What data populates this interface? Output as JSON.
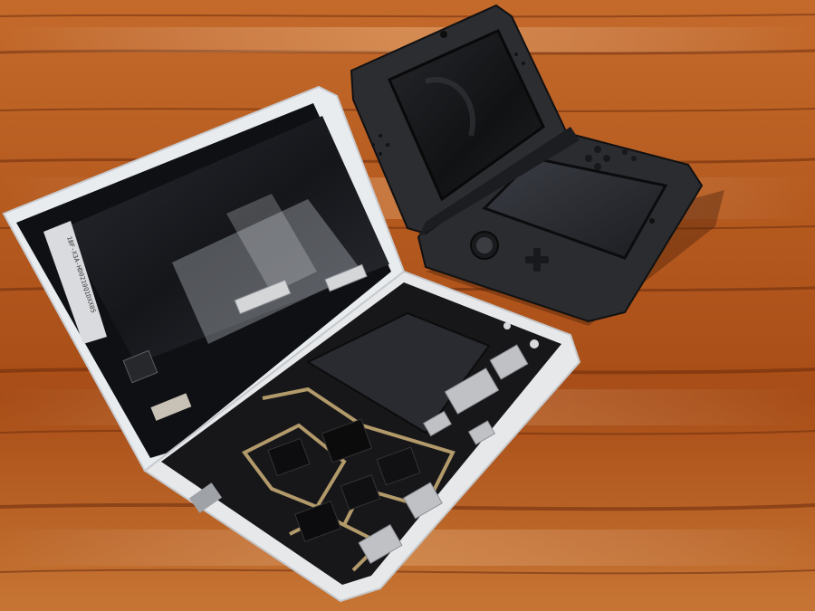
{
  "scene": {
    "description_free": true,
    "objects": [
      {
        "name": "open-folding-phone",
        "state": "disassembled"
      },
      {
        "name": "handheld-game-console",
        "state": "open"
      }
    ],
    "surface": "wooden-table",
    "colors": {
      "wood_dark": "#6b2c0c",
      "wood_mid": "#a9521d",
      "wood_light": "#d98a45",
      "phone_frame": "#e9ecef",
      "screen_glass": "#1b1d22",
      "pcb": "#17171a",
      "pcb_gold": "#b39a6a",
      "console_body": "#2a2c30"
    }
  },
  "phone_panel": {
    "printed_label": "1BF-X3A-HD0210Q1DXX05"
  }
}
